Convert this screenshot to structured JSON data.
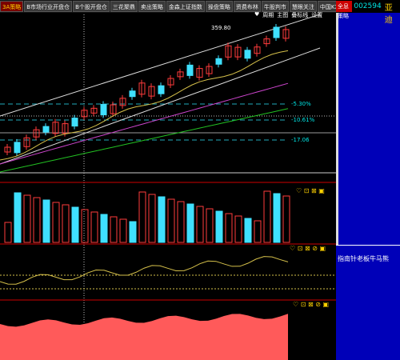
{
  "toolbar": {
    "tabs": [
      "3A策略",
      "B市场行业开盘仓",
      "B个股开盘仓",
      "三花聚鼎",
      "卖出策略",
      "金森上证指数",
      "操盘策略",
      "资费布林",
      "牛股判市",
      "慧眼关注",
      "中国KX优策略"
    ]
  },
  "chart_controls": {
    "fav": "周期",
    "main": "主图",
    "lines": "叠标线",
    "settings": "设置"
  },
  "stock": {
    "button": "全息策略",
    "code": "002594",
    "name": "比亚迪"
  },
  "price_labels": {
    "high": "359.80",
    "p1": "-5.30%",
    "p2": "-10.61%",
    "p3": "-17.06"
  },
  "indicator_label": "指南针老板牛马熊",
  "colors": {
    "up": "#ff3b3b",
    "down": "#3fe0ff",
    "panel": "#0000b8",
    "ma1": "#d5c04a",
    "ma2": "#cc44cc",
    "ma3": "#22c022"
  }
}
